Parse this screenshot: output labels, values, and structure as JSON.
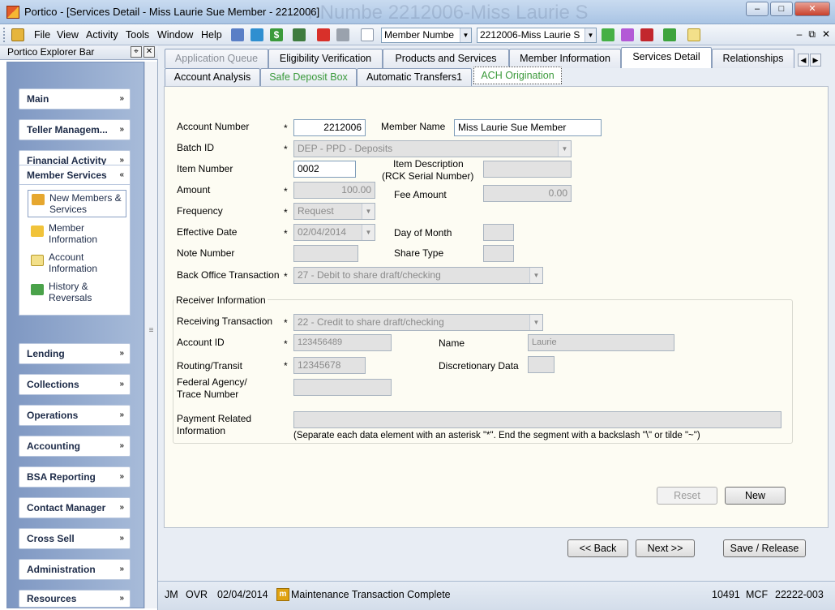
{
  "window": {
    "title": "Portico - [Services Detail - Miss Laurie Sue Member - 2212006]",
    "ghost_text": "r Numbe   2212006-Miss Laurie S"
  },
  "menu": [
    "File",
    "View",
    "Activity",
    "Tools",
    "Window",
    "Help"
  ],
  "toolbar": {
    "search_type": "Member Numbe",
    "member_select": "2212006-Miss Laurie S"
  },
  "explorer": {
    "title": "Portico Explorer Bar",
    "groups": [
      "Main",
      "Teller Managem...",
      "Financial Activity",
      "Member Services",
      "Lending",
      "Collections",
      "Operations",
      "Accounting",
      "BSA Reporting",
      "Contact Manager",
      "Cross Sell",
      "Administration",
      "Resources"
    ],
    "member_services_items": [
      "New Members & Services",
      "Member Information",
      "Account Information",
      "History & Reversals"
    ]
  },
  "tabs": {
    "top": [
      "Application Queue",
      "Eligibility Verification",
      "Products and Services",
      "Member Information",
      "Services Detail",
      "Relationships"
    ],
    "sub": [
      "Account Analysis",
      "Safe Deposit Box",
      "Automatic Transfers1",
      "ACH Origination"
    ]
  },
  "form": {
    "account_number_label": "Account Number",
    "account_number": "2212006",
    "member_name_label": "Member Name",
    "member_name": "Miss Laurie Sue Member",
    "batch_id_label": "Batch ID",
    "batch_id": "DEP - PPD - Deposits",
    "item_number_label": "Item Number",
    "item_number": "0002",
    "item_description_label": "Item Description",
    "item_description_label2": "(RCK Serial Number)",
    "item_description": "",
    "amount_label": "Amount",
    "amount": "100.00",
    "fee_amount_label": "Fee Amount",
    "fee_amount": "0.00",
    "frequency_label": "Frequency",
    "frequency": "Request",
    "effective_date_label": "Effective Date",
    "effective_date": "02/04/2014",
    "day_of_month_label": "Day of Month",
    "note_number_label": "Note Number",
    "share_type_label": "Share Type",
    "back_office_label": "Back Office Transaction",
    "back_office": "27 - Debit to share draft/checking",
    "receiver_legend": "Receiver Information",
    "receiving_transaction_label": "Receiving Transaction",
    "receiving_transaction": "22 - Credit to share draft/checking",
    "account_id_label": "Account ID",
    "account_id": "123456489",
    "name_label": "Name",
    "name": "Laurie",
    "routing_label": "Routing/Transit",
    "routing": "12345678",
    "discretionary_label": "Discretionary Data",
    "federal_label1": "Federal Agency/",
    "federal_label2": "Trace Number",
    "payment_label1": "Payment Related",
    "payment_label2": "Information",
    "payment_hint": "(Separate each data element with an asterisk \"*\".  End the segment with a backslash \"\\\" or tilde \"~\")",
    "required_mark": "*"
  },
  "buttons": {
    "reset": "Reset",
    "new": "New",
    "back": "<< Back",
    "next": "Next >>",
    "save": "Save / Release"
  },
  "status": {
    "user": "JM",
    "mode": "OVR",
    "date": "02/04/2014",
    "message": "Maintenance Transaction Complete",
    "num": "10491",
    "branch": "MCF",
    "terminal": "22222-003"
  }
}
